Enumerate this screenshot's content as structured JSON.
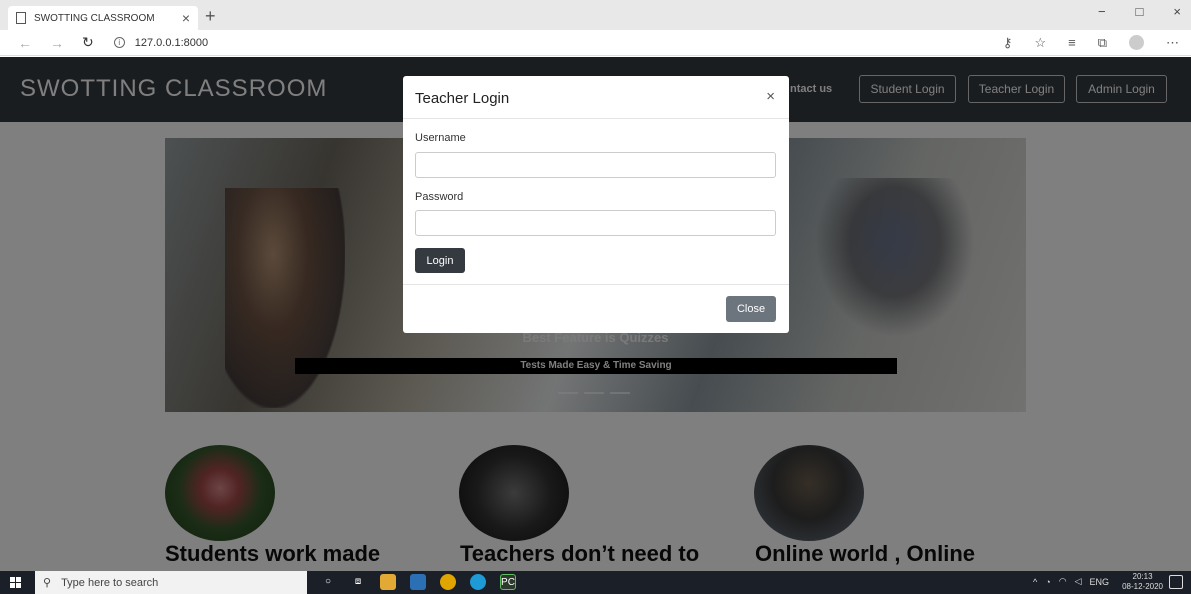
{
  "browser": {
    "tab_title": "SWOTTING CLASSROOM",
    "tab_close": "×",
    "new_tab": "+",
    "url": "127.0.0.1:8000",
    "win_min": "−",
    "win_max": "□",
    "win_close": "×"
  },
  "navbar": {
    "brand": "SWOTTING CLASSROOM",
    "contact_label": "ntact us",
    "student_login": "Student Login",
    "teacher_login": "Teacher Login",
    "admin_login": "Admin Login"
  },
  "carousel": {
    "caption_title": "Best Feature is Quizzes",
    "caption_text": "Tests Made Easy & Time Saving"
  },
  "features": [
    {
      "title": "Students work made"
    },
    {
      "title": "Teachers don’t need to"
    },
    {
      "title": "Online world , Online"
    }
  ],
  "modal": {
    "title": "Teacher Login",
    "close_x": "×",
    "username_label": "Username",
    "password_label": "Password",
    "login_label": "Login",
    "close_label": "Close"
  },
  "taskbar": {
    "search_placeholder": "Type here to search",
    "lang": "ENG",
    "time": "20:13",
    "date": "08-12-2020"
  }
}
